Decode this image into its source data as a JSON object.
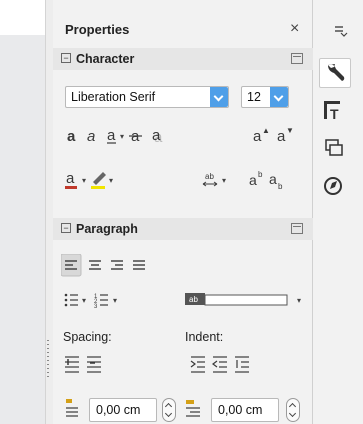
{
  "panel": {
    "title": "Properties",
    "close_glyph": "×"
  },
  "character": {
    "title": "Character",
    "font_name": "Liberation Serif",
    "font_size": "12",
    "text_glyph": "a",
    "superscript_glyph": "a",
    "subscript_glyph": "a",
    "sup_mark": "b",
    "spacing_glyph": "ab"
  },
  "paragraph": {
    "title": "Paragraph",
    "spacing_label": "Spacing:",
    "indent_label": "Indent:",
    "spacing_value": "0,00 cm",
    "indent_value": "0,00 cm"
  },
  "colors": {
    "accent": "#4f9fe8",
    "font_color": "#c0392b",
    "highlight_color": "#f1e500",
    "active_align": "#d8d8d8"
  },
  "tabbar": {
    "menu_icon": "hamburger-icon",
    "tabs": [
      "properties-wrench-icon",
      "styles-icon",
      "gallery-icon",
      "navigator-icon"
    ]
  }
}
